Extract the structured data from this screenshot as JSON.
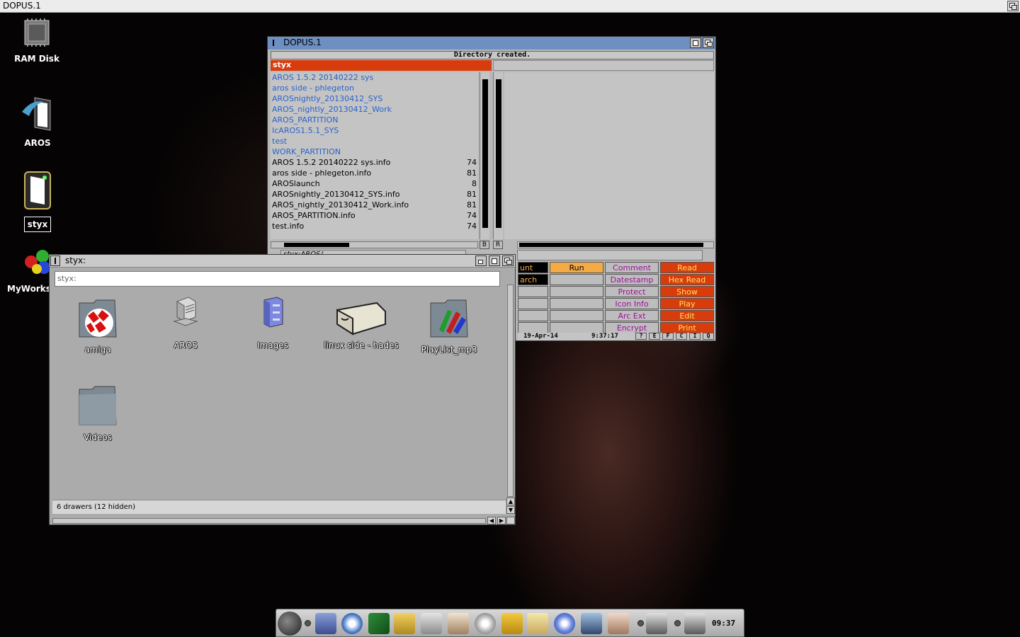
{
  "screen": {
    "title": "DOPUS.1"
  },
  "desktop_icons": [
    {
      "label": "RAM Disk"
    },
    {
      "label": "AROS"
    },
    {
      "label": "styx"
    },
    {
      "label": "MyWorksp"
    }
  ],
  "dopus": {
    "title": "DOPUS.1",
    "status": "Directory created.",
    "left_header": "styx",
    "left_path": "styx:AROS/",
    "files": [
      {
        "name": "AROS 1.5.2 20140222 sys",
        "size": "",
        "dir": true
      },
      {
        "name": "aros side - phlegeton",
        "size": "",
        "dir": true
      },
      {
        "name": "AROSnightly_20130412_SYS",
        "size": "",
        "dir": true
      },
      {
        "name": "AROS_nightly_20130412_Work",
        "size": "",
        "dir": true
      },
      {
        "name": "AROS_PARTITION",
        "size": "",
        "dir": true
      },
      {
        "name": "IcAROS1.5.1_SYS",
        "size": "",
        "dir": true
      },
      {
        "name": "test",
        "size": "",
        "dir": true
      },
      {
        "name": "WORK_PARTITION",
        "size": "",
        "dir": true
      },
      {
        "name": "AROS 1.5.2 20140222 sys.info",
        "size": "74",
        "dir": false
      },
      {
        "name": "aros side - phlegeton.info",
        "size": "81",
        "dir": false
      },
      {
        "name": "AROSlaunch",
        "size": "8",
        "dir": false
      },
      {
        "name": "AROSnightly_20130412_SYS.info",
        "size": "81",
        "dir": false
      },
      {
        "name": "AROS_nightly_20130412_Work.info",
        "size": "81",
        "dir": false
      },
      {
        "name": "AROS_PARTITION.info",
        "size": "74",
        "dir": false
      },
      {
        "name": "test.info",
        "size": "74",
        "dir": false
      }
    ],
    "mid_buttons": [
      "B",
      "R"
    ],
    "buttons": {
      "col_a": [
        "unt",
        "arch",
        "",
        "",
        "",
        ""
      ],
      "col_b": [
        "Run",
        "",
        "",
        "",
        "",
        ""
      ],
      "col_c": [
        "Comment",
        "Datestamp",
        "Protect",
        "Icon Info",
        "Arc Ext",
        "Encrypt"
      ],
      "col_d": [
        "Read",
        "Hex Read",
        "Show",
        "Play",
        "Edit",
        "Print"
      ]
    },
    "date": "19-Apr-14",
    "time": "9:37:17",
    "mini_buttons": [
      "?",
      "E",
      "F",
      "C",
      "I",
      "Q"
    ]
  },
  "styx": {
    "title": "styx:",
    "path_value": "styx:",
    "icons": [
      {
        "label": "amiga"
      },
      {
        "label": "AROS"
      },
      {
        "label": "Images"
      },
      {
        "label": "linux side - hades"
      },
      {
        "label": "PlayList_mp3"
      },
      {
        "label": "Videos"
      }
    ],
    "status": "6 drawers (12 hidden)"
  },
  "dock": {
    "clock": "09:37"
  }
}
